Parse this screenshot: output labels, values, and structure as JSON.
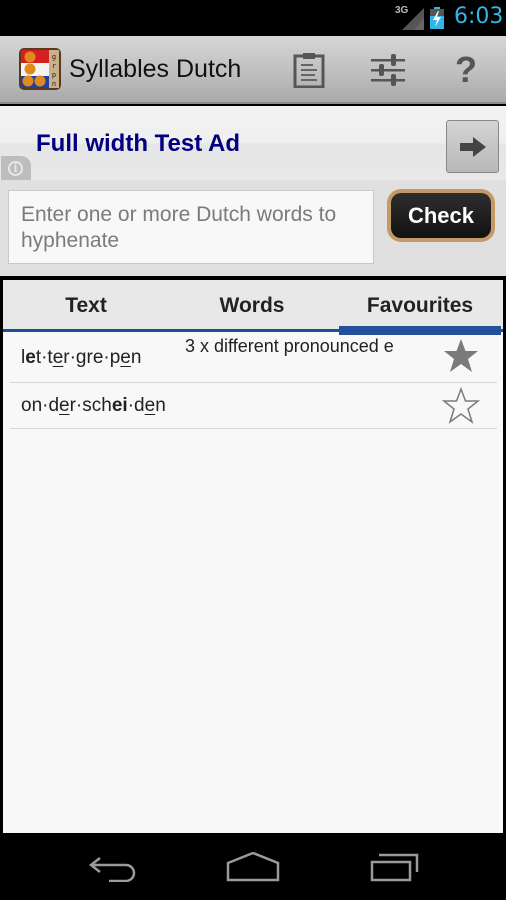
{
  "status_bar": {
    "network": "3G",
    "time": "6:03",
    "icons": [
      "signal-icon",
      "battery-charging-icon"
    ]
  },
  "action_bar": {
    "app_title": "Syllables Dutch",
    "app_icon": "app-logo-icon",
    "actions": [
      {
        "name": "clipboard",
        "icon": "clipboard-icon"
      },
      {
        "name": "settings",
        "icon": "sliders-icon"
      },
      {
        "name": "help",
        "icon": "help-icon",
        "glyph": "?"
      }
    ]
  },
  "ad": {
    "text": "Full width Test Ad",
    "info_glyph": "i",
    "arrow_icon": "arrow-right-icon"
  },
  "input": {
    "value": "",
    "placeholder": "Enter one or more Dutch words to hyphenate",
    "check_label": "Check",
    "check_border_color": "#c39a64"
  },
  "tabs": {
    "items": [
      {
        "label": "Text",
        "active": false
      },
      {
        "label": "Words",
        "active": false
      },
      {
        "label": "Favourites",
        "active": true
      }
    ],
    "accent_color": "#22509a"
  },
  "favourites": [
    {
      "word": "let·ter·gre·pen",
      "segments": [
        {
          "t": "l",
          "s": ""
        },
        {
          "t": "e",
          "s": "b"
        },
        {
          "t": "t·t",
          "s": ""
        },
        {
          "t": "e",
          "s": "u"
        },
        {
          "t": "r·gre·p",
          "s": ""
        },
        {
          "t": "e",
          "s": "u"
        },
        {
          "t": "n",
          "s": ""
        }
      ],
      "note": "3 x different pronounced e",
      "starred": true
    },
    {
      "word": "on·der·schei·den",
      "segments": [
        {
          "t": "on·d",
          "s": ""
        },
        {
          "t": "e",
          "s": "u"
        },
        {
          "t": "r·sch",
          "s": ""
        },
        {
          "t": "ei",
          "s": "b"
        },
        {
          "t": "·d",
          "s": ""
        },
        {
          "t": "e",
          "s": "u"
        },
        {
          "t": "n",
          "s": ""
        }
      ],
      "note": "",
      "starred": false
    }
  ],
  "nav_bar": {
    "buttons": [
      "back",
      "home",
      "recent-apps"
    ]
  }
}
